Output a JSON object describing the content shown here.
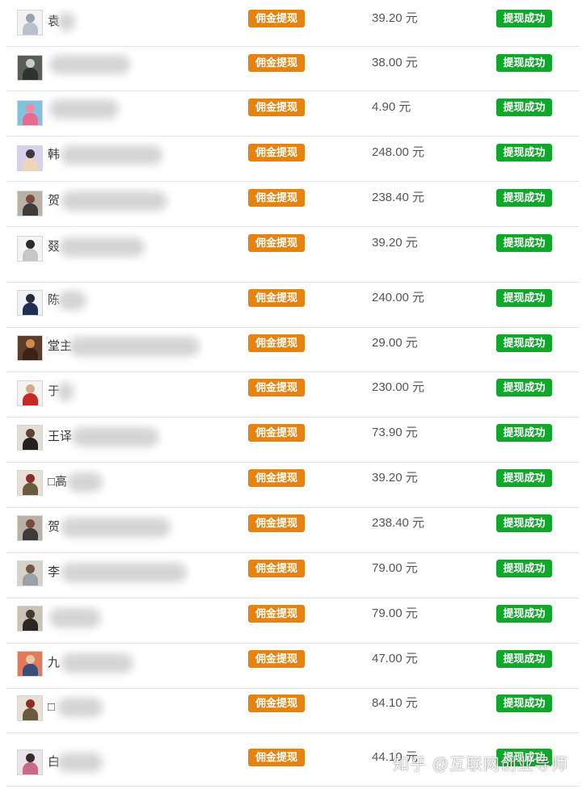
{
  "colors": {
    "commission_tag": "#e6820e",
    "status_success": "#10a82a",
    "divider": "#e3e3e3"
  },
  "rows": [
    {
      "name": "袁",
      "tag": "佣金提现",
      "amount": "39.20 元",
      "status": "提现成功",
      "avatar_icon": "user-avatar-icon"
    },
    {
      "name": "",
      "tag": "佣金提现",
      "amount": "38.00 元",
      "status": "提现成功",
      "avatar_icon": "user-avatar-icon"
    },
    {
      "name": "",
      "tag": "佣金提现",
      "amount": "4.90 元",
      "status": "提现成功",
      "avatar_icon": "user-avatar-icon"
    },
    {
      "name": "韩",
      "tag": "佣金提现",
      "amount": "248.00 元",
      "status": "提现成功",
      "avatar_icon": "user-avatar-icon"
    },
    {
      "name": "贺",
      "tag": "佣金提现",
      "amount": "238.40 元",
      "status": "提现成功",
      "avatar_icon": "user-avatar-icon"
    },
    {
      "name": "叕",
      "tag": "佣金提现",
      "amount": "39.20 元",
      "status": "提现成功",
      "avatar_icon": "user-avatar-icon"
    },
    {
      "name": "陈",
      "tag": "佣金提现",
      "amount": "240.00 元",
      "status": "提现成功",
      "avatar_icon": "user-avatar-icon"
    },
    {
      "name": "堂主",
      "tag": "佣金提现",
      "amount": "29.00 元",
      "status": "提现成功",
      "avatar_icon": "user-avatar-icon"
    },
    {
      "name": "于",
      "tag": "佣金提现",
      "amount": "230.00 元",
      "status": "提现成功",
      "avatar_icon": "user-avatar-icon"
    },
    {
      "name": "王译",
      "tag": "佣金提现",
      "amount": "73.90 元",
      "status": "提现成功",
      "avatar_icon": "user-avatar-icon"
    },
    {
      "name": "□高",
      "tag": "佣金提现",
      "amount": "39.20 元",
      "status": "提现成功",
      "avatar_icon": "user-avatar-icon"
    },
    {
      "name": "贺",
      "tag": "佣金提现",
      "amount": "238.40 元",
      "status": "提现成功",
      "avatar_icon": "user-avatar-icon"
    },
    {
      "name": "李",
      "tag": "佣金提现",
      "amount": "79.00 元",
      "status": "提现成功",
      "avatar_icon": "user-avatar-icon"
    },
    {
      "name": "",
      "tag": "佣金提现",
      "amount": "79.00 元",
      "status": "提现成功",
      "avatar_icon": "user-avatar-icon"
    },
    {
      "name": "九",
      "tag": "佣金提现",
      "amount": "47.00 元",
      "status": "提现成功",
      "avatar_icon": "user-avatar-icon"
    },
    {
      "name": "□",
      "tag": "佣金提现",
      "amount": "84.10 元",
      "status": "提现成功",
      "avatar_icon": "user-avatar-icon"
    },
    {
      "name": "白",
      "tag": "佣金提现",
      "amount": "44.10 元",
      "status": "提现成功",
      "avatar_icon": "user-avatar-icon"
    }
  ],
  "watermark": "知乎 @互联网创业导师"
}
